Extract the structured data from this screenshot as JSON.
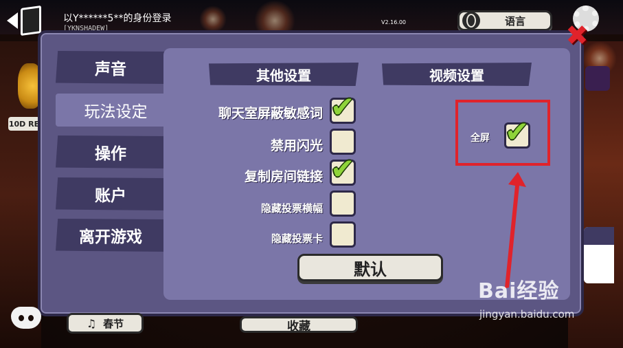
{
  "header": {
    "login_text": "以Y******5**的身份登录",
    "login_sub": "[YKNSHADEW]",
    "version": "V2.16.00",
    "language_button": "语言"
  },
  "settings": {
    "sidebar": [
      {
        "label": "声音",
        "active": false
      },
      {
        "label": "玩法设定",
        "active": true
      },
      {
        "label": "操作",
        "active": false
      },
      {
        "label": "账户",
        "active": false
      },
      {
        "label": "离开游戏",
        "active": false
      }
    ],
    "other_title": "其他设置",
    "video_title": "视频设置",
    "options": [
      {
        "label": "聊天室屏蔽敏感词",
        "checked": true
      },
      {
        "label": "禁用闪光",
        "checked": false
      },
      {
        "label": "复制房间链接",
        "checked": true
      },
      {
        "label": "隐藏投票横幅",
        "checked": false
      },
      {
        "label": "隐藏投票卡",
        "checked": false
      }
    ],
    "fullscreen": {
      "label": "全屏",
      "checked": true
    },
    "default_button": "默认"
  },
  "background": {
    "ten_label": "10D RE",
    "spring_button": "春节",
    "collect_button": "收藏"
  },
  "watermark": {
    "logo": "Bai经验",
    "url": "jingyan.baidu.com"
  },
  "colors": {
    "modal_bg": "#5c5683",
    "panel_bg": "#7b76a8",
    "title_bg": "#3f3a62",
    "check_green": "#8fd43a",
    "annotation_red": "#e0232b"
  }
}
